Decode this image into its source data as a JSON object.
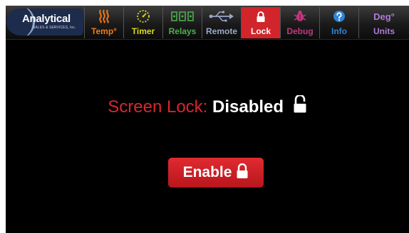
{
  "logo": {
    "name": "Analytical",
    "tagline": "SALES & SERVICES, Inc."
  },
  "nav": {
    "tabs": [
      {
        "label": "Temp°",
        "icon": "heat-waves-icon",
        "color": "#f07a1a",
        "active": false
      },
      {
        "label": "Timer",
        "icon": "timer-dial-icon",
        "color": "#d8d81f",
        "active": false
      },
      {
        "label": "Relays",
        "icon": "relay-switch-icon",
        "color": "#4fae4f",
        "active": false
      },
      {
        "label": "Remote",
        "icon": "usb-icon",
        "color": "#9aa7c9",
        "active": false
      },
      {
        "label": "Lock",
        "icon": "lock-icon",
        "color": "#ffffff",
        "active": true
      },
      {
        "label": "Debug",
        "icon": "bug-icon",
        "color": "#c2387f",
        "active": false
      },
      {
        "label": "Info",
        "icon": "question-circle-icon",
        "color": "#2f84d8",
        "active": false
      },
      {
        "label": "Units",
        "icon": "degree-icon",
        "icon_text": "Deg°",
        "color": "#b07ad8",
        "active": false
      }
    ]
  },
  "screen_lock": {
    "label": "Screen Lock:",
    "status": "Disabled",
    "status_icon": "unlocked-padlock-icon"
  },
  "enable_button": {
    "label": "Enable",
    "icon": "locked-padlock-icon"
  },
  "colors": {
    "accent_red": "#d1242b",
    "background": "#000000",
    "text": "#ffffff"
  }
}
